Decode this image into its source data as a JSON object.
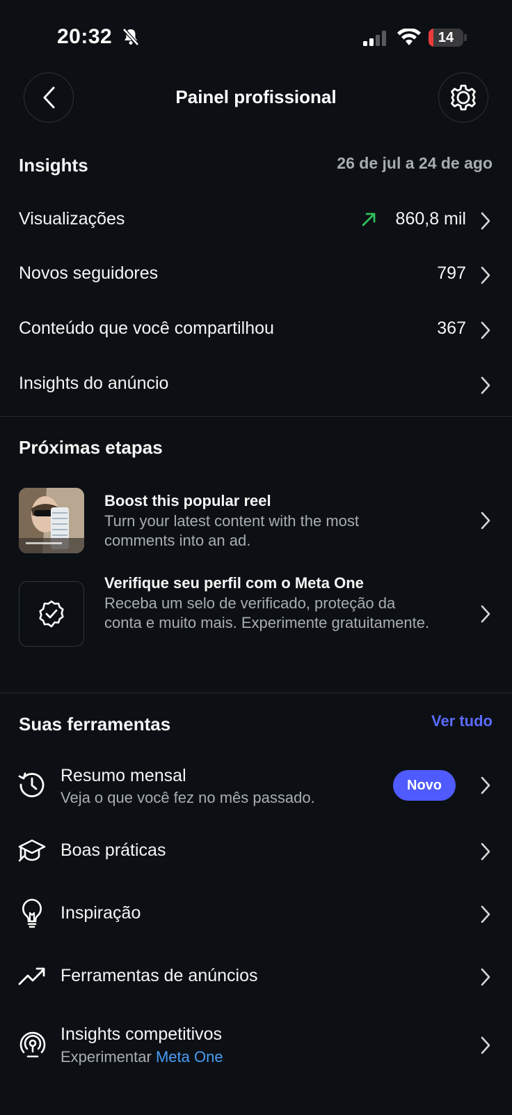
{
  "status": {
    "time": "20:32",
    "battery": "14",
    "battery_level": 0.14
  },
  "header": {
    "title": "Painel profissional"
  },
  "insights": {
    "title": "Insights",
    "date_range": "26 de jul a 24 de ago",
    "rows": [
      {
        "label": "Visualizações",
        "value": "860,8 mil",
        "trend": "up"
      },
      {
        "label": "Novos seguidores",
        "value": "797"
      },
      {
        "label": "Conteúdo que você compartilhou",
        "value": "367"
      },
      {
        "label": "Insights do anúncio",
        "value": ""
      }
    ]
  },
  "next_steps": {
    "title": "Próximas etapas",
    "items": [
      {
        "title": "Boost this popular reel",
        "description": "Turn your latest content with the most comments into an ad."
      },
      {
        "title": "Verifique seu perfil com o Meta One",
        "description": "Receba um selo de verificado, proteção da conta e muito mais. Experimente gratuitamente."
      }
    ]
  },
  "tools": {
    "title": "Suas ferramentas",
    "see_all": "Ver tudo",
    "items": [
      {
        "label": "Resumo mensal",
        "subtitle": "Veja o que você fez no mês passado.",
        "badge": "Novo",
        "icon": "history-icon"
      },
      {
        "label": "Boas práticas",
        "icon": "graduation-cap-icon"
      },
      {
        "label": "Inspiração",
        "icon": "lightbulb-icon"
      },
      {
        "label": "Ferramentas de anúncios",
        "icon": "trending-up-icon"
      },
      {
        "label": "Insights competitivos",
        "subtitle_prefix": "Experimentar",
        "subtitle_link": "Meta One",
        "icon": "broadcast-icon"
      }
    ]
  },
  "colors": {
    "background": "#0c1014",
    "accent_blue": "#4f5bff",
    "link_blue": "#4a9cf5",
    "trend_green": "#2fbf5b",
    "battery_low": "#eb3b3b"
  }
}
